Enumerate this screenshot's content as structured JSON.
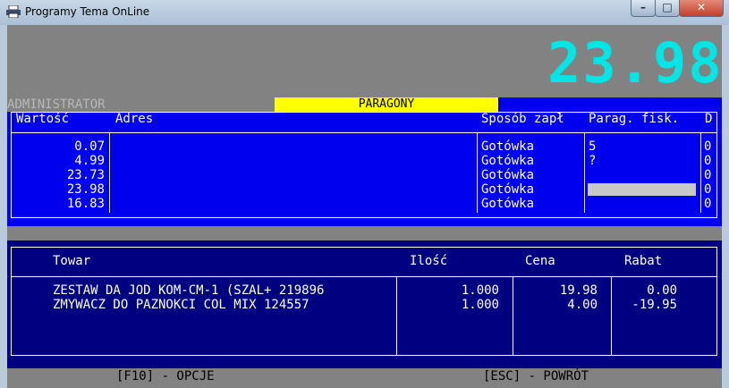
{
  "window": {
    "title": "Programy Tema OnLine",
    "min_glyph": "–",
    "max_glyph": "□",
    "close_glyph": "✕"
  },
  "display": {
    "total": "23.98",
    "user": "ADMINISTRATOR",
    "section": "PARAGONY"
  },
  "receipts": {
    "headers": [
      "Wartość",
      "Adres",
      "Sposób zapł",
      "Parag. fisk.",
      "D"
    ],
    "rows": [
      {
        "value": "0.07",
        "address": "",
        "payment": "Gotówka",
        "fisk": "5",
        "d": "0"
      },
      {
        "value": "4.99",
        "address": "",
        "payment": "Gotówka",
        "fisk": "?",
        "d": "0"
      },
      {
        "value": "23.73",
        "address": "",
        "payment": "Gotówka",
        "fisk": "",
        "d": "0"
      },
      {
        "value": "23.98",
        "address": "",
        "payment": "Gotówka",
        "fisk": "",
        "d": "0"
      },
      {
        "value": "16.83",
        "address": "",
        "payment": "Gotówka",
        "fisk": "",
        "d": "0"
      }
    ]
  },
  "items": {
    "headers": [
      "Towar",
      "Ilość",
      "Cena",
      "Rabat"
    ],
    "rows": [
      {
        "name": "ZESTAW DA JOD KOM-CM-1 (SZAL+ 219896",
        "qty": "1.000",
        "price": "19.98",
        "discount": "0.00"
      },
      {
        "name": "ZMYWACZ DO PAZNOKCI COL MIX 124557",
        "qty": "1.000",
        "price": "4.00",
        "discount": "-19.95"
      }
    ]
  },
  "footer": {
    "options": "[F10] - OPCJE",
    "back": "[ESC] - POWRÓT"
  },
  "colors": {
    "display": "#00e5e5",
    "panel_top": "#0000ee",
    "panel_bottom": "#000080",
    "section_bar": "#ffff00"
  }
}
